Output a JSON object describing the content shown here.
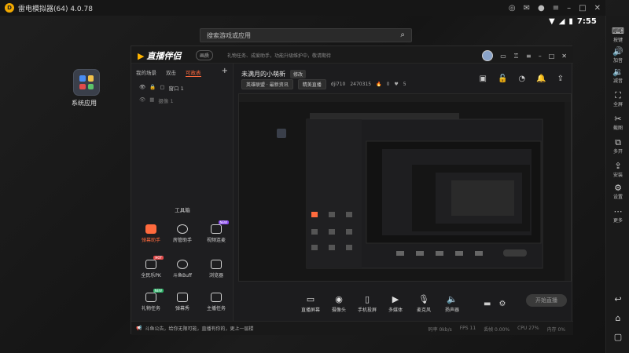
{
  "emulator": {
    "title": "雷电模拟器(64) 4.0.78",
    "logo_text": "D",
    "time": "7:55",
    "controls": [
      "gamepad-icon",
      "mail-icon",
      "record-icon",
      "menu-icon",
      "minimize-icon",
      "maximize-icon",
      "close-icon"
    ]
  },
  "right_toolbar": [
    {
      "icon": "keyboard-icon",
      "label": "按键"
    },
    {
      "icon": "volume-up-icon",
      "label": "加音"
    },
    {
      "icon": "volume-down-icon",
      "label": "减音"
    },
    {
      "icon": "fullscreen-icon",
      "label": "全屏"
    },
    {
      "icon": "scissors-icon",
      "label": "截图"
    },
    {
      "icon": "multi-open-icon",
      "label": "多开"
    },
    {
      "icon": "install-icon",
      "label": "安装"
    },
    {
      "icon": "settings-icon",
      "label": "设置"
    },
    {
      "icon": "more-icon",
      "label": "更多"
    }
  ],
  "nav_buttons": [
    "back-icon",
    "home-icon",
    "recent-icon"
  ],
  "desktop": {
    "search_placeholder": "搜索游戏或应用",
    "app_label": "系统应用"
  },
  "app": {
    "name": "直播伴侣",
    "badge": "画质",
    "slogan": "礼物任务、成爱助手，功能升级维护中，敬请期待",
    "left_tabs": [
      "我的场景",
      "双击",
      "可政表"
    ],
    "active_tab_index": 2,
    "sources": [
      {
        "label": "窗口 1"
      },
      {
        "label": "摄像 1"
      }
    ],
    "toolbox_title": "工具箱",
    "tools": [
      {
        "label": "弹幕助手",
        "highlight": true,
        "tag": ""
      },
      {
        "label": "房管助手",
        "highlight": false,
        "tag": ""
      },
      {
        "label": "视频连麦",
        "highlight": false,
        "tag": "NEW"
      },
      {
        "label": "全民乐PK",
        "highlight": false,
        "tag": "HOT"
      },
      {
        "label": "斗鱼Buff",
        "highlight": false,
        "tag": ""
      },
      {
        "label": "浏览器",
        "highlight": false,
        "tag": ""
      },
      {
        "label": "礼物任务",
        "highlight": false,
        "tag": "NEW"
      },
      {
        "label": "弹幕秀",
        "highlight": false,
        "tag": ""
      },
      {
        "label": "主播任务",
        "highlight": false,
        "tag": ""
      }
    ],
    "stream_title": "未满月的小萌新",
    "edit_label": "修改",
    "category": "英雄联盟 · 最新资讯",
    "room_btn": "精美直播",
    "room_id": "dji710",
    "viewer_id": "2470315",
    "fire_count": "0",
    "like_count": "5",
    "bottom_tools": [
      {
        "icon": "screen-share-icon",
        "label": "直播屏幕"
      },
      {
        "icon": "camera-icon",
        "label": "摄像头"
      },
      {
        "icon": "phone-cast-icon",
        "label": "手机投屏"
      },
      {
        "icon": "media-icon",
        "label": "多媒体"
      },
      {
        "icon": "microphone-icon",
        "label": "麦克风"
      },
      {
        "icon": "speaker-icon",
        "label": "扬声器"
      }
    ],
    "start_label": "开始直播",
    "notice": "斗鱼公告，给你无限可能，直播有你的，更上一层楼",
    "stats": [
      "码率 0kb/s",
      "FPS 11",
      "丢帧 0.00%",
      "CPU 27%",
      "内存 0%"
    ]
  }
}
